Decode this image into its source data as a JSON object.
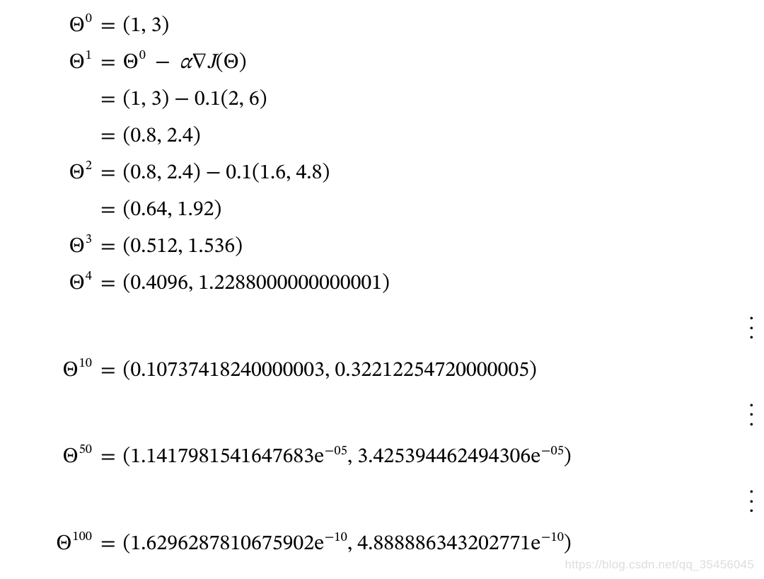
{
  "sym": {
    "Theta": "Θ",
    "alpha": "α",
    "nabla": "∇",
    "J": "J",
    "minus": "−",
    "eq": "=",
    "dot": "."
  },
  "lines": {
    "l0": {
      "sup": "0",
      "rhs_plain": "(1, 3)"
    },
    "l1a": {
      "sup": "1",
      "rhs_is_formula": true,
      "rhs_prefix_sup": "0"
    },
    "l1b": {
      "rhs_plain": "(1, 3) − 0.1(2, 6)"
    },
    "l1c": {
      "rhs_plain": "(0.8, 2.4)"
    },
    "l2a": {
      "sup": "2",
      "rhs_plain": "(0.8, 2.4) − 0.1(1.6, 4.8)"
    },
    "l2b": {
      "rhs_plain": "(0.64, 1.92)"
    },
    "l3": {
      "sup": "3",
      "rhs_plain": "(0.512, 1.536)"
    },
    "l4": {
      "sup": "4",
      "rhs_plain": "(0.4096, 1.2288000000000001)"
    },
    "l10": {
      "sup": "10",
      "rhs_plain": "(0.10737418240000003, 0.32212254720000005)"
    },
    "l50": {
      "sup": "50",
      "rhs_sci": {
        "a": "(1.1417981541647683e",
        "ea": "−05",
        "mid": ", 3.425394462494306e",
        "eb": "−05",
        "close": ")"
      }
    },
    "l100": {
      "sup": "100",
      "rhs_sci": {
        "a": "(1.6296287810675902e",
        "ea": "−10",
        "mid": ", 4.888886343202771e",
        "eb": "−10",
        "close": ")"
      }
    }
  },
  "watermark": "https://blog.csdn.net/qq_35456045"
}
